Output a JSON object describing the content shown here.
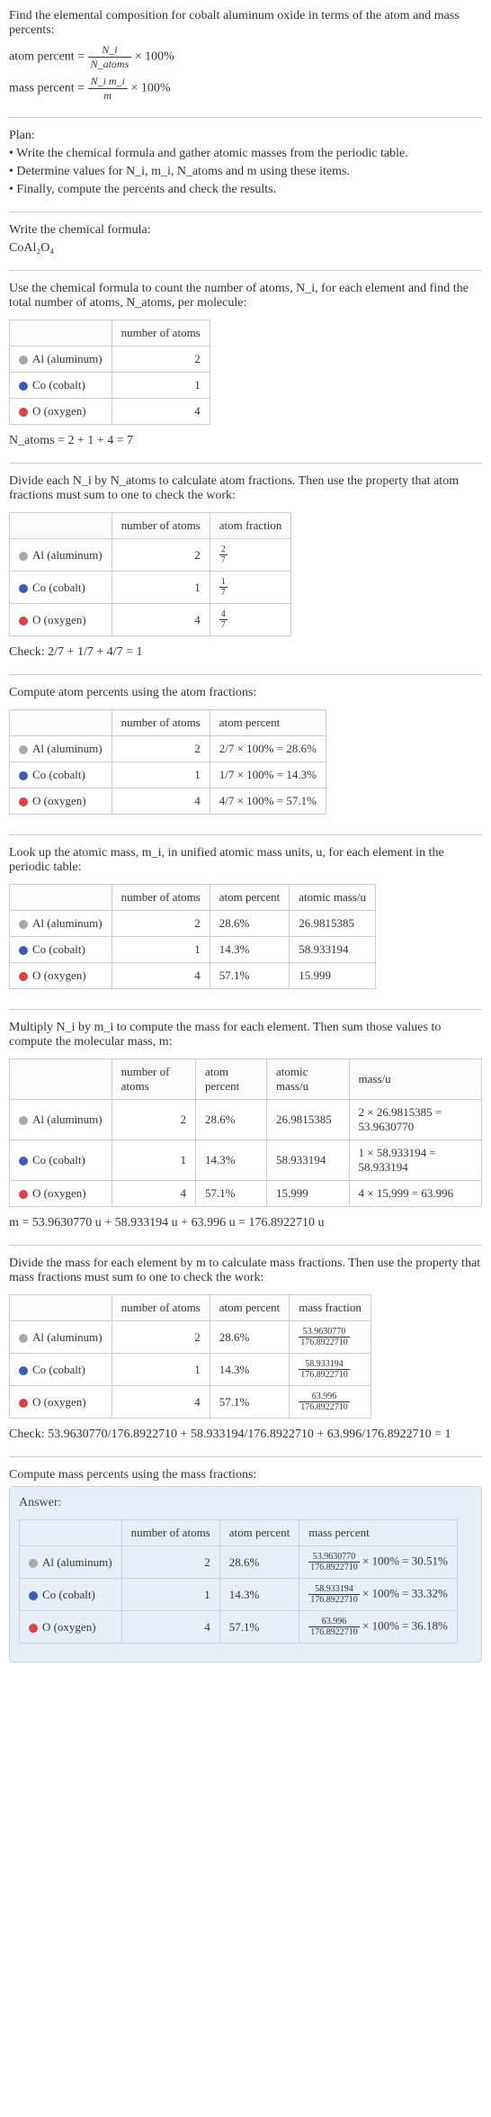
{
  "intro": "Find the elemental composition for cobalt aluminum oxide in terms of the atom and mass percents:",
  "atom_percent_formula": {
    "label": "atom percent =",
    "num": "N_i",
    "den": "N_atoms",
    "suffix": "× 100%"
  },
  "mass_percent_formula": {
    "label": "mass percent =",
    "num": "N_i m_i",
    "den": "m",
    "suffix": "× 100%"
  },
  "plan_label": "Plan:",
  "plan": [
    "• Write the chemical formula and gather atomic masses from the periodic table.",
    "• Determine values for N_i, m_i, N_atoms and m using these items.",
    "• Finally, compute the percents and check the results."
  ],
  "write_formula_text": "Write the chemical formula:",
  "chemical_formula": "CoAl₂O₄",
  "count_atoms_text": "Use the chemical formula to count the number of atoms, N_i, for each element and find the total number of atoms, N_atoms, per molecule:",
  "n_atoms_line": "N_atoms = 2 + 1 + 4 = 7",
  "elements": {
    "al": {
      "label": "Al (aluminum)",
      "count": "2"
    },
    "co": {
      "label": "Co (cobalt)",
      "count": "1"
    },
    "o": {
      "label": "O (oxygen)",
      "count": "4"
    }
  },
  "headers": {
    "number_of_atoms": "number of atoms",
    "atom_fraction": "atom fraction",
    "atom_percent": "atom percent",
    "atomic_mass": "atomic mass/u",
    "mass_u": "mass/u",
    "mass_fraction": "mass fraction",
    "mass_percent": "mass percent"
  },
  "atom_fraction_text": "Divide each N_i by N_atoms to calculate atom fractions. Then use the property that atom fractions must sum to one to check the work:",
  "atom_fractions": {
    "al": {
      "num": "2",
      "den": "7"
    },
    "co": {
      "num": "1",
      "den": "7"
    },
    "o": {
      "num": "4",
      "den": "7"
    }
  },
  "atom_fraction_check": "Check: 2/7 + 1/7 + 4/7 = 1",
  "atom_percent_text": "Compute atom percents using the atom fractions:",
  "atom_percents": {
    "al": "2/7 × 100% = 28.6%",
    "co": "1/7 × 100% = 14.3%",
    "o": "4/7 × 100% = 57.1%"
  },
  "atom_percent_short": {
    "al": "28.6%",
    "co": "14.3%",
    "o": "57.1%"
  },
  "atomic_mass_text": "Look up the atomic mass, m_i, in unified atomic mass units, u, for each element in the periodic table:",
  "atomic_masses": {
    "al": "26.9815385",
    "co": "58.933194",
    "o": "15.999"
  },
  "mass_compute_text": "Multiply N_i by m_i to compute the mass for each element. Then sum those values to compute the molecular mass, m:",
  "masses_u": {
    "al": "2 × 26.9815385 = 53.9630770",
    "co": "1 × 58.933194 = 58.933194",
    "o": "4 × 15.999 = 63.996"
  },
  "m_total": "m = 53.9630770 u + 58.933194 u + 63.996 u = 176.8922710 u",
  "mass_fraction_text": "Divide the mass for each element by m to calculate mass fractions. Then use the property that mass fractions must sum to one to check the work:",
  "mass_fractions": {
    "al": {
      "num": "53.9630770",
      "den": "176.8922710"
    },
    "co": {
      "num": "58.933194",
      "den": "176.8922710"
    },
    "o": {
      "num": "63.996",
      "den": "176.8922710"
    }
  },
  "mass_fraction_check": "Check: 53.9630770/176.8922710 + 58.933194/176.8922710 + 63.996/176.8922710 = 1",
  "mass_percent_text": "Compute mass percents using the mass fractions:",
  "answer_label": "Answer:",
  "mass_percents": {
    "al": {
      "num": "53.9630770",
      "den": "176.8922710",
      "result": "× 100% = 30.51%"
    },
    "co": {
      "num": "58.933194",
      "den": "176.8922710",
      "result": "× 100% = 33.32%"
    },
    "o": {
      "num": "63.996",
      "den": "176.8922710",
      "result": "× 100% = 36.18%"
    }
  },
  "chart_data": {
    "type": "table",
    "title": "Elemental composition of CoAl2O4",
    "columns": [
      "element",
      "number_of_atoms",
      "atom_percent",
      "atomic_mass_u",
      "mass_u",
      "mass_percent"
    ],
    "rows": [
      {
        "element": "Al (aluminum)",
        "number_of_atoms": 2,
        "atom_percent": 28.6,
        "atomic_mass_u": 26.9815385,
        "mass_u": 53.963077,
        "mass_percent": 30.51
      },
      {
        "element": "Co (cobalt)",
        "number_of_atoms": 1,
        "atom_percent": 14.3,
        "atomic_mass_u": 58.933194,
        "mass_u": 58.933194,
        "mass_percent": 33.32
      },
      {
        "element": "O (oxygen)",
        "number_of_atoms": 4,
        "atom_percent": 57.1,
        "atomic_mass_u": 15.999,
        "mass_u": 63.996,
        "mass_percent": 36.18
      }
    ],
    "totals": {
      "N_atoms": 7,
      "molecular_mass_u": 176.892271
    }
  }
}
